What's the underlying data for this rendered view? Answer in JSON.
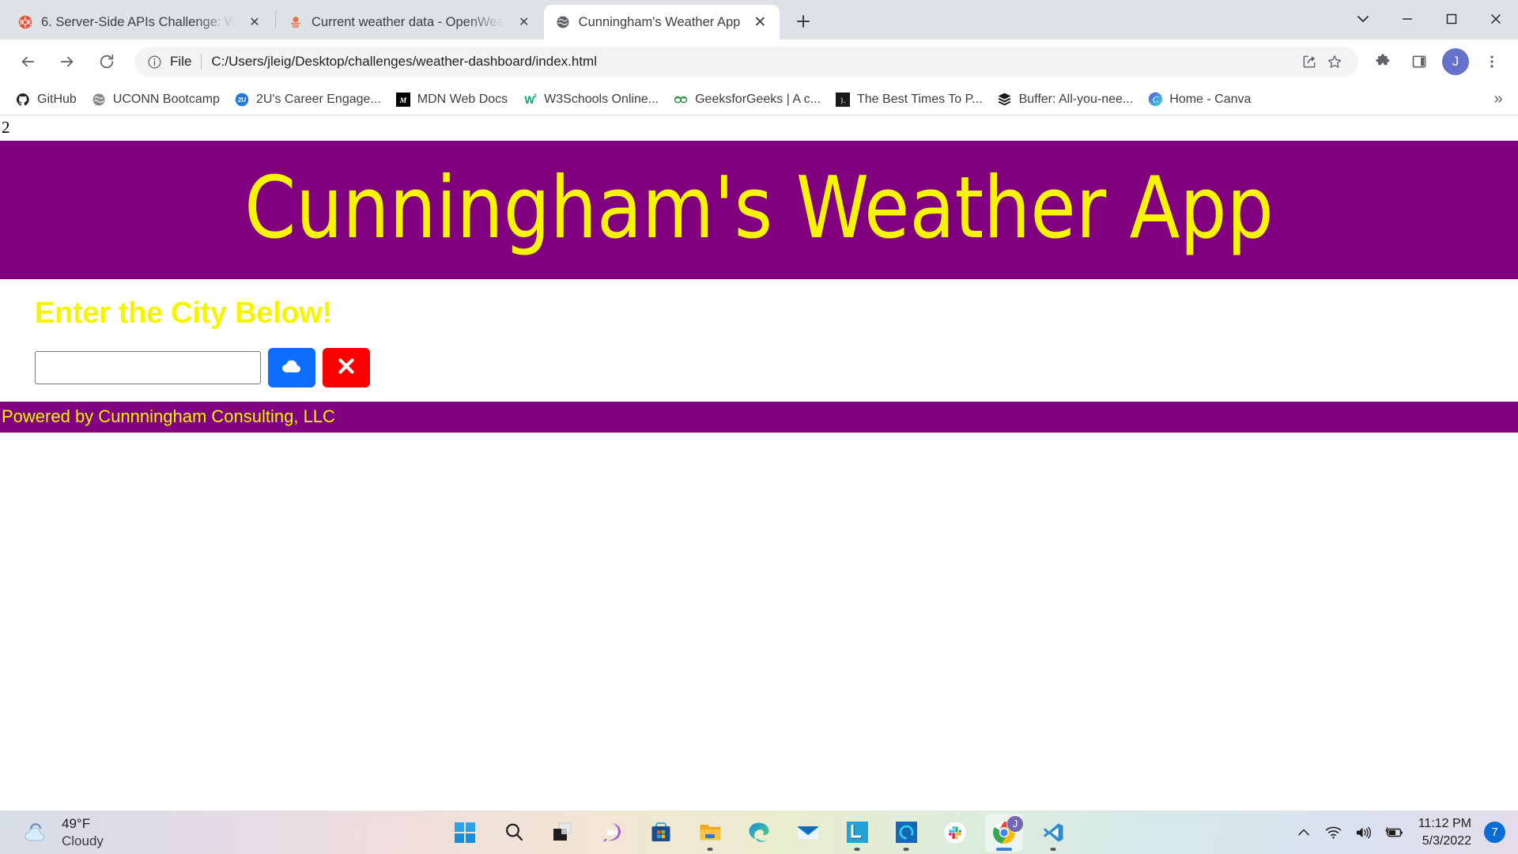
{
  "browser": {
    "tabs": [
      {
        "title": "6. Server-Side APIs Challenge: We",
        "favicon": "codepen-icon",
        "active": false,
        "close_label": "✕"
      },
      {
        "title": "Current weather data - OpenWea",
        "favicon": "openweather-icon",
        "active": false,
        "close_label": "✕"
      },
      {
        "title": "Cunningham's Weather App",
        "favicon": "globe-icon",
        "active": true,
        "close_label": "✕"
      }
    ],
    "newtab_label": "+",
    "window_controls": {
      "minimize": "─",
      "maximize": "□",
      "close": "✕",
      "tabsearch": "⌄"
    },
    "omnibox": {
      "scheme_label": "File",
      "url": "C:/Users/jleig/Desktop/challenges/weather-dashboard/index.html",
      "info_icon": "info-circle-icon",
      "share_icon": "share-icon",
      "bookmark_icon": "star-icon"
    },
    "toolbar": {
      "back_icon": "back-arrow-icon",
      "forward_icon": "forward-arrow-icon",
      "reload_icon": "reload-icon",
      "extensions_icon": "puzzle-icon",
      "sidepanel_icon": "side-panel-icon",
      "menu_icon": "three-dots-icon",
      "profile_initial": "J",
      "profile_color": "#6672c9"
    },
    "bookmarks": [
      {
        "label": "GitHub",
        "icon": "github-icon"
      },
      {
        "label": "UCONN Bootcamp",
        "icon": "globe-icon"
      },
      {
        "label": "2U's Career Engage...",
        "icon": "2u-icon"
      },
      {
        "label": "MDN Web Docs",
        "icon": "mdn-icon"
      },
      {
        "label": "W3Schools Online...",
        "icon": "w3schools-icon"
      },
      {
        "label": "GeeksforGeeks | A c...",
        "icon": "geeksforgeeks-icon"
      },
      {
        "label": "The Best Times To P...",
        "icon": "buffer-article-icon"
      },
      {
        "label": "Buffer: All-you-nee...",
        "icon": "buffer-icon"
      },
      {
        "label": "Home - Canva",
        "icon": "canva-icon"
      }
    ],
    "bookmarks_overflow_label": "»"
  },
  "page": {
    "stray_text": "2",
    "title": "Cunningham's Weather App",
    "form": {
      "label": "Enter the City Below!",
      "input_value": "",
      "input_placeholder": "",
      "search_button_icon": "cloud-icon",
      "clear_button_icon": "x-icon"
    },
    "footer_text": "Powered by Cunnningham Consulting, LLC",
    "colors": {
      "banner_background": "#800080",
      "banner_text": "#f5f500",
      "search_button": "#0d6efd",
      "clear_button": "#fa0000"
    }
  },
  "taskbar": {
    "weather": {
      "temperature": "49°F",
      "condition": "Cloudy",
      "icon": "cloud-weather-icon"
    },
    "apps": [
      {
        "name": "start-button",
        "icon": "windows-logo-icon",
        "state": "idle"
      },
      {
        "name": "search-button",
        "icon": "search-icon",
        "state": "idle"
      },
      {
        "name": "task-view",
        "icon": "task-view-icon",
        "state": "idle"
      },
      {
        "name": "chat",
        "icon": "chat-icon",
        "state": "idle"
      },
      {
        "name": "microsoft-store",
        "icon": "store-icon",
        "state": "idle"
      },
      {
        "name": "file-explorer",
        "icon": "folder-icon",
        "state": "running"
      },
      {
        "name": "microsoft-edge",
        "icon": "edge-icon",
        "state": "idle"
      },
      {
        "name": "mail",
        "icon": "mail-icon",
        "state": "idle"
      },
      {
        "name": "lastpass",
        "icon": "l-app-icon",
        "state": "running"
      },
      {
        "name": "alexa",
        "icon": "alexa-icon",
        "state": "running"
      },
      {
        "name": "slack",
        "icon": "slack-icon",
        "state": "idle"
      },
      {
        "name": "google-chrome",
        "icon": "chrome-icon",
        "state": "active",
        "badge": "J"
      },
      {
        "name": "vs-code",
        "icon": "vscode-icon",
        "state": "running"
      }
    ],
    "tray": {
      "overflow_icon": "chevron-up-icon",
      "wifi_icon": "wifi-icon",
      "volume_icon": "speaker-icon",
      "battery_icon": "battery-charging-icon",
      "time": "11:12 PM",
      "date": "5/3/2022",
      "notification_count": "7"
    }
  }
}
